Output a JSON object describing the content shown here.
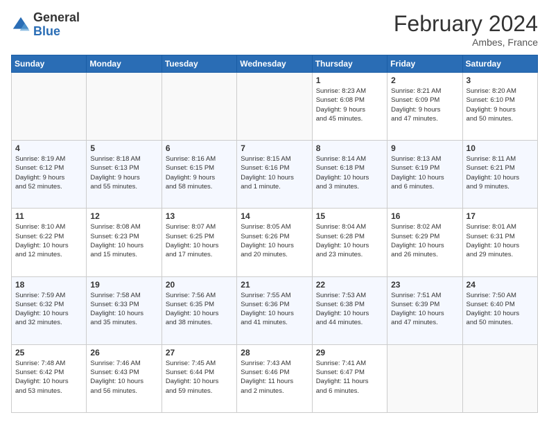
{
  "logo": {
    "general": "General",
    "blue": "Blue"
  },
  "header": {
    "month": "February 2024",
    "location": "Ambes, France"
  },
  "weekdays": [
    "Sunday",
    "Monday",
    "Tuesday",
    "Wednesday",
    "Thursday",
    "Friday",
    "Saturday"
  ],
  "weeks": [
    [
      {
        "day": "",
        "info": ""
      },
      {
        "day": "",
        "info": ""
      },
      {
        "day": "",
        "info": ""
      },
      {
        "day": "",
        "info": ""
      },
      {
        "day": "1",
        "info": "Sunrise: 8:23 AM\nSunset: 6:08 PM\nDaylight: 9 hours\nand 45 minutes."
      },
      {
        "day": "2",
        "info": "Sunrise: 8:21 AM\nSunset: 6:09 PM\nDaylight: 9 hours\nand 47 minutes."
      },
      {
        "day": "3",
        "info": "Sunrise: 8:20 AM\nSunset: 6:10 PM\nDaylight: 9 hours\nand 50 minutes."
      }
    ],
    [
      {
        "day": "4",
        "info": "Sunrise: 8:19 AM\nSunset: 6:12 PM\nDaylight: 9 hours\nand 52 minutes."
      },
      {
        "day": "5",
        "info": "Sunrise: 8:18 AM\nSunset: 6:13 PM\nDaylight: 9 hours\nand 55 minutes."
      },
      {
        "day": "6",
        "info": "Sunrise: 8:16 AM\nSunset: 6:15 PM\nDaylight: 9 hours\nand 58 minutes."
      },
      {
        "day": "7",
        "info": "Sunrise: 8:15 AM\nSunset: 6:16 PM\nDaylight: 10 hours\nand 1 minute."
      },
      {
        "day": "8",
        "info": "Sunrise: 8:14 AM\nSunset: 6:18 PM\nDaylight: 10 hours\nand 3 minutes."
      },
      {
        "day": "9",
        "info": "Sunrise: 8:13 AM\nSunset: 6:19 PM\nDaylight: 10 hours\nand 6 minutes."
      },
      {
        "day": "10",
        "info": "Sunrise: 8:11 AM\nSunset: 6:21 PM\nDaylight: 10 hours\nand 9 minutes."
      }
    ],
    [
      {
        "day": "11",
        "info": "Sunrise: 8:10 AM\nSunset: 6:22 PM\nDaylight: 10 hours\nand 12 minutes."
      },
      {
        "day": "12",
        "info": "Sunrise: 8:08 AM\nSunset: 6:23 PM\nDaylight: 10 hours\nand 15 minutes."
      },
      {
        "day": "13",
        "info": "Sunrise: 8:07 AM\nSunset: 6:25 PM\nDaylight: 10 hours\nand 17 minutes."
      },
      {
        "day": "14",
        "info": "Sunrise: 8:05 AM\nSunset: 6:26 PM\nDaylight: 10 hours\nand 20 minutes."
      },
      {
        "day": "15",
        "info": "Sunrise: 8:04 AM\nSunset: 6:28 PM\nDaylight: 10 hours\nand 23 minutes."
      },
      {
        "day": "16",
        "info": "Sunrise: 8:02 AM\nSunset: 6:29 PM\nDaylight: 10 hours\nand 26 minutes."
      },
      {
        "day": "17",
        "info": "Sunrise: 8:01 AM\nSunset: 6:31 PM\nDaylight: 10 hours\nand 29 minutes."
      }
    ],
    [
      {
        "day": "18",
        "info": "Sunrise: 7:59 AM\nSunset: 6:32 PM\nDaylight: 10 hours\nand 32 minutes."
      },
      {
        "day": "19",
        "info": "Sunrise: 7:58 AM\nSunset: 6:33 PM\nDaylight: 10 hours\nand 35 minutes."
      },
      {
        "day": "20",
        "info": "Sunrise: 7:56 AM\nSunset: 6:35 PM\nDaylight: 10 hours\nand 38 minutes."
      },
      {
        "day": "21",
        "info": "Sunrise: 7:55 AM\nSunset: 6:36 PM\nDaylight: 10 hours\nand 41 minutes."
      },
      {
        "day": "22",
        "info": "Sunrise: 7:53 AM\nSunset: 6:38 PM\nDaylight: 10 hours\nand 44 minutes."
      },
      {
        "day": "23",
        "info": "Sunrise: 7:51 AM\nSunset: 6:39 PM\nDaylight: 10 hours\nand 47 minutes."
      },
      {
        "day": "24",
        "info": "Sunrise: 7:50 AM\nSunset: 6:40 PM\nDaylight: 10 hours\nand 50 minutes."
      }
    ],
    [
      {
        "day": "25",
        "info": "Sunrise: 7:48 AM\nSunset: 6:42 PM\nDaylight: 10 hours\nand 53 minutes."
      },
      {
        "day": "26",
        "info": "Sunrise: 7:46 AM\nSunset: 6:43 PM\nDaylight: 10 hours\nand 56 minutes."
      },
      {
        "day": "27",
        "info": "Sunrise: 7:45 AM\nSunset: 6:44 PM\nDaylight: 10 hours\nand 59 minutes."
      },
      {
        "day": "28",
        "info": "Sunrise: 7:43 AM\nSunset: 6:46 PM\nDaylight: 11 hours\nand 2 minutes."
      },
      {
        "day": "29",
        "info": "Sunrise: 7:41 AM\nSunset: 6:47 PM\nDaylight: 11 hours\nand 6 minutes."
      },
      {
        "day": "",
        "info": ""
      },
      {
        "day": "",
        "info": ""
      }
    ]
  ]
}
